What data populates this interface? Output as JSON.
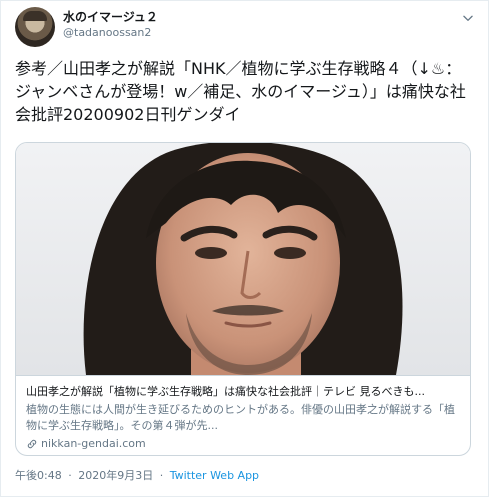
{
  "user": {
    "display_name": "水のイマージュ２",
    "handle": "@tadanoossan2"
  },
  "tweet": {
    "text": "参考／山田孝之が解説「NHK／植物に学ぶ生存戦略４（↓♨：ジャンベさんが登場！w／補足、水のイマージュ）」は痛快な社会批評20200902日刊ゲンダイ"
  },
  "card": {
    "title": "山田孝之が解説「植物に学ぶ生存戦略」は痛快な社会批評｜テレビ 見るべきも...",
    "description": "植物の生態には人間が生き延びるためのヒントがある。俳優の山田孝之が解説する「植物に学ぶ生存戦略」。その第４弾が先...",
    "domain": "nikkan-gendai.com"
  },
  "meta": {
    "time": "午後0:48",
    "date": "2020年9月3日",
    "separator": "·",
    "source": "Twitter Web App"
  },
  "icons": {
    "caret": "chevron-down-icon",
    "link": "link-icon",
    "avatar": "avatar"
  },
  "colors": {
    "link_blue": "#1b95e0",
    "secondary_text": "#657786",
    "border": "#ccd6dd"
  }
}
